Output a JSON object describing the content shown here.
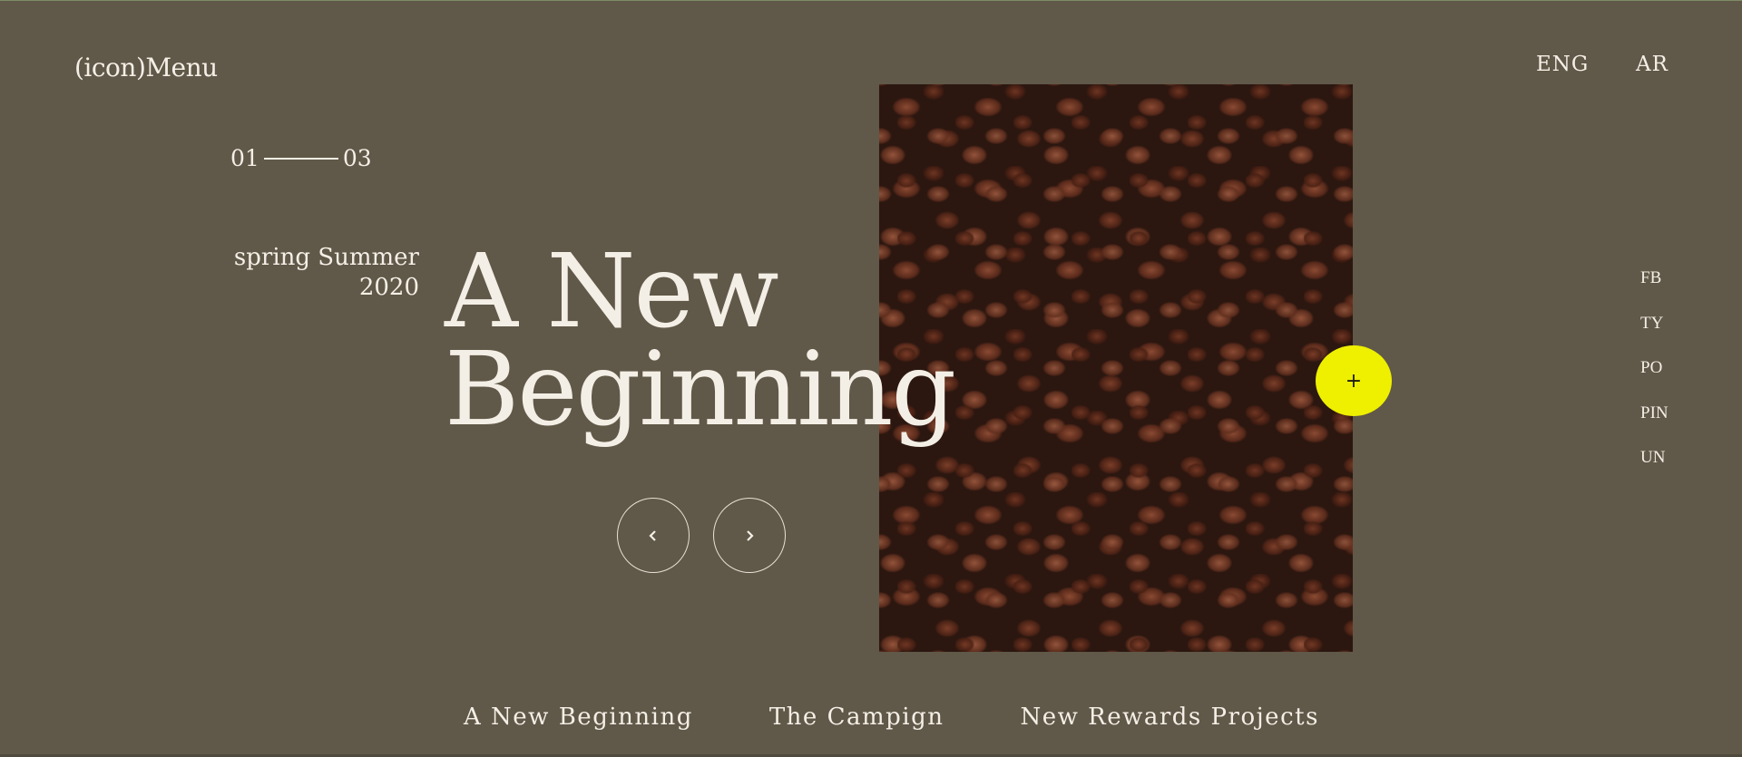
{
  "header": {
    "menu_label": "(icon)Menu",
    "languages": [
      "ENG",
      "AR"
    ]
  },
  "slider": {
    "current": "01",
    "total": "03",
    "season_line1": "spring Summer",
    "season_line2": "2020",
    "title_line1": "A New",
    "title_line2": "Beginning",
    "prev_icon": "chevron-left-icon",
    "next_icon": "chevron-right-icon",
    "plus_label": "+",
    "plus_color": "#eef000"
  },
  "social": [
    "FB",
    "TY",
    "PO",
    "PIN",
    "UN"
  ],
  "bottom_nav": [
    "A New Beginning",
    "The Campign",
    "New Rewards Projects"
  ],
  "colors": {
    "background": "#605848",
    "text": "#f4efe6",
    "accent": "#eef000"
  }
}
